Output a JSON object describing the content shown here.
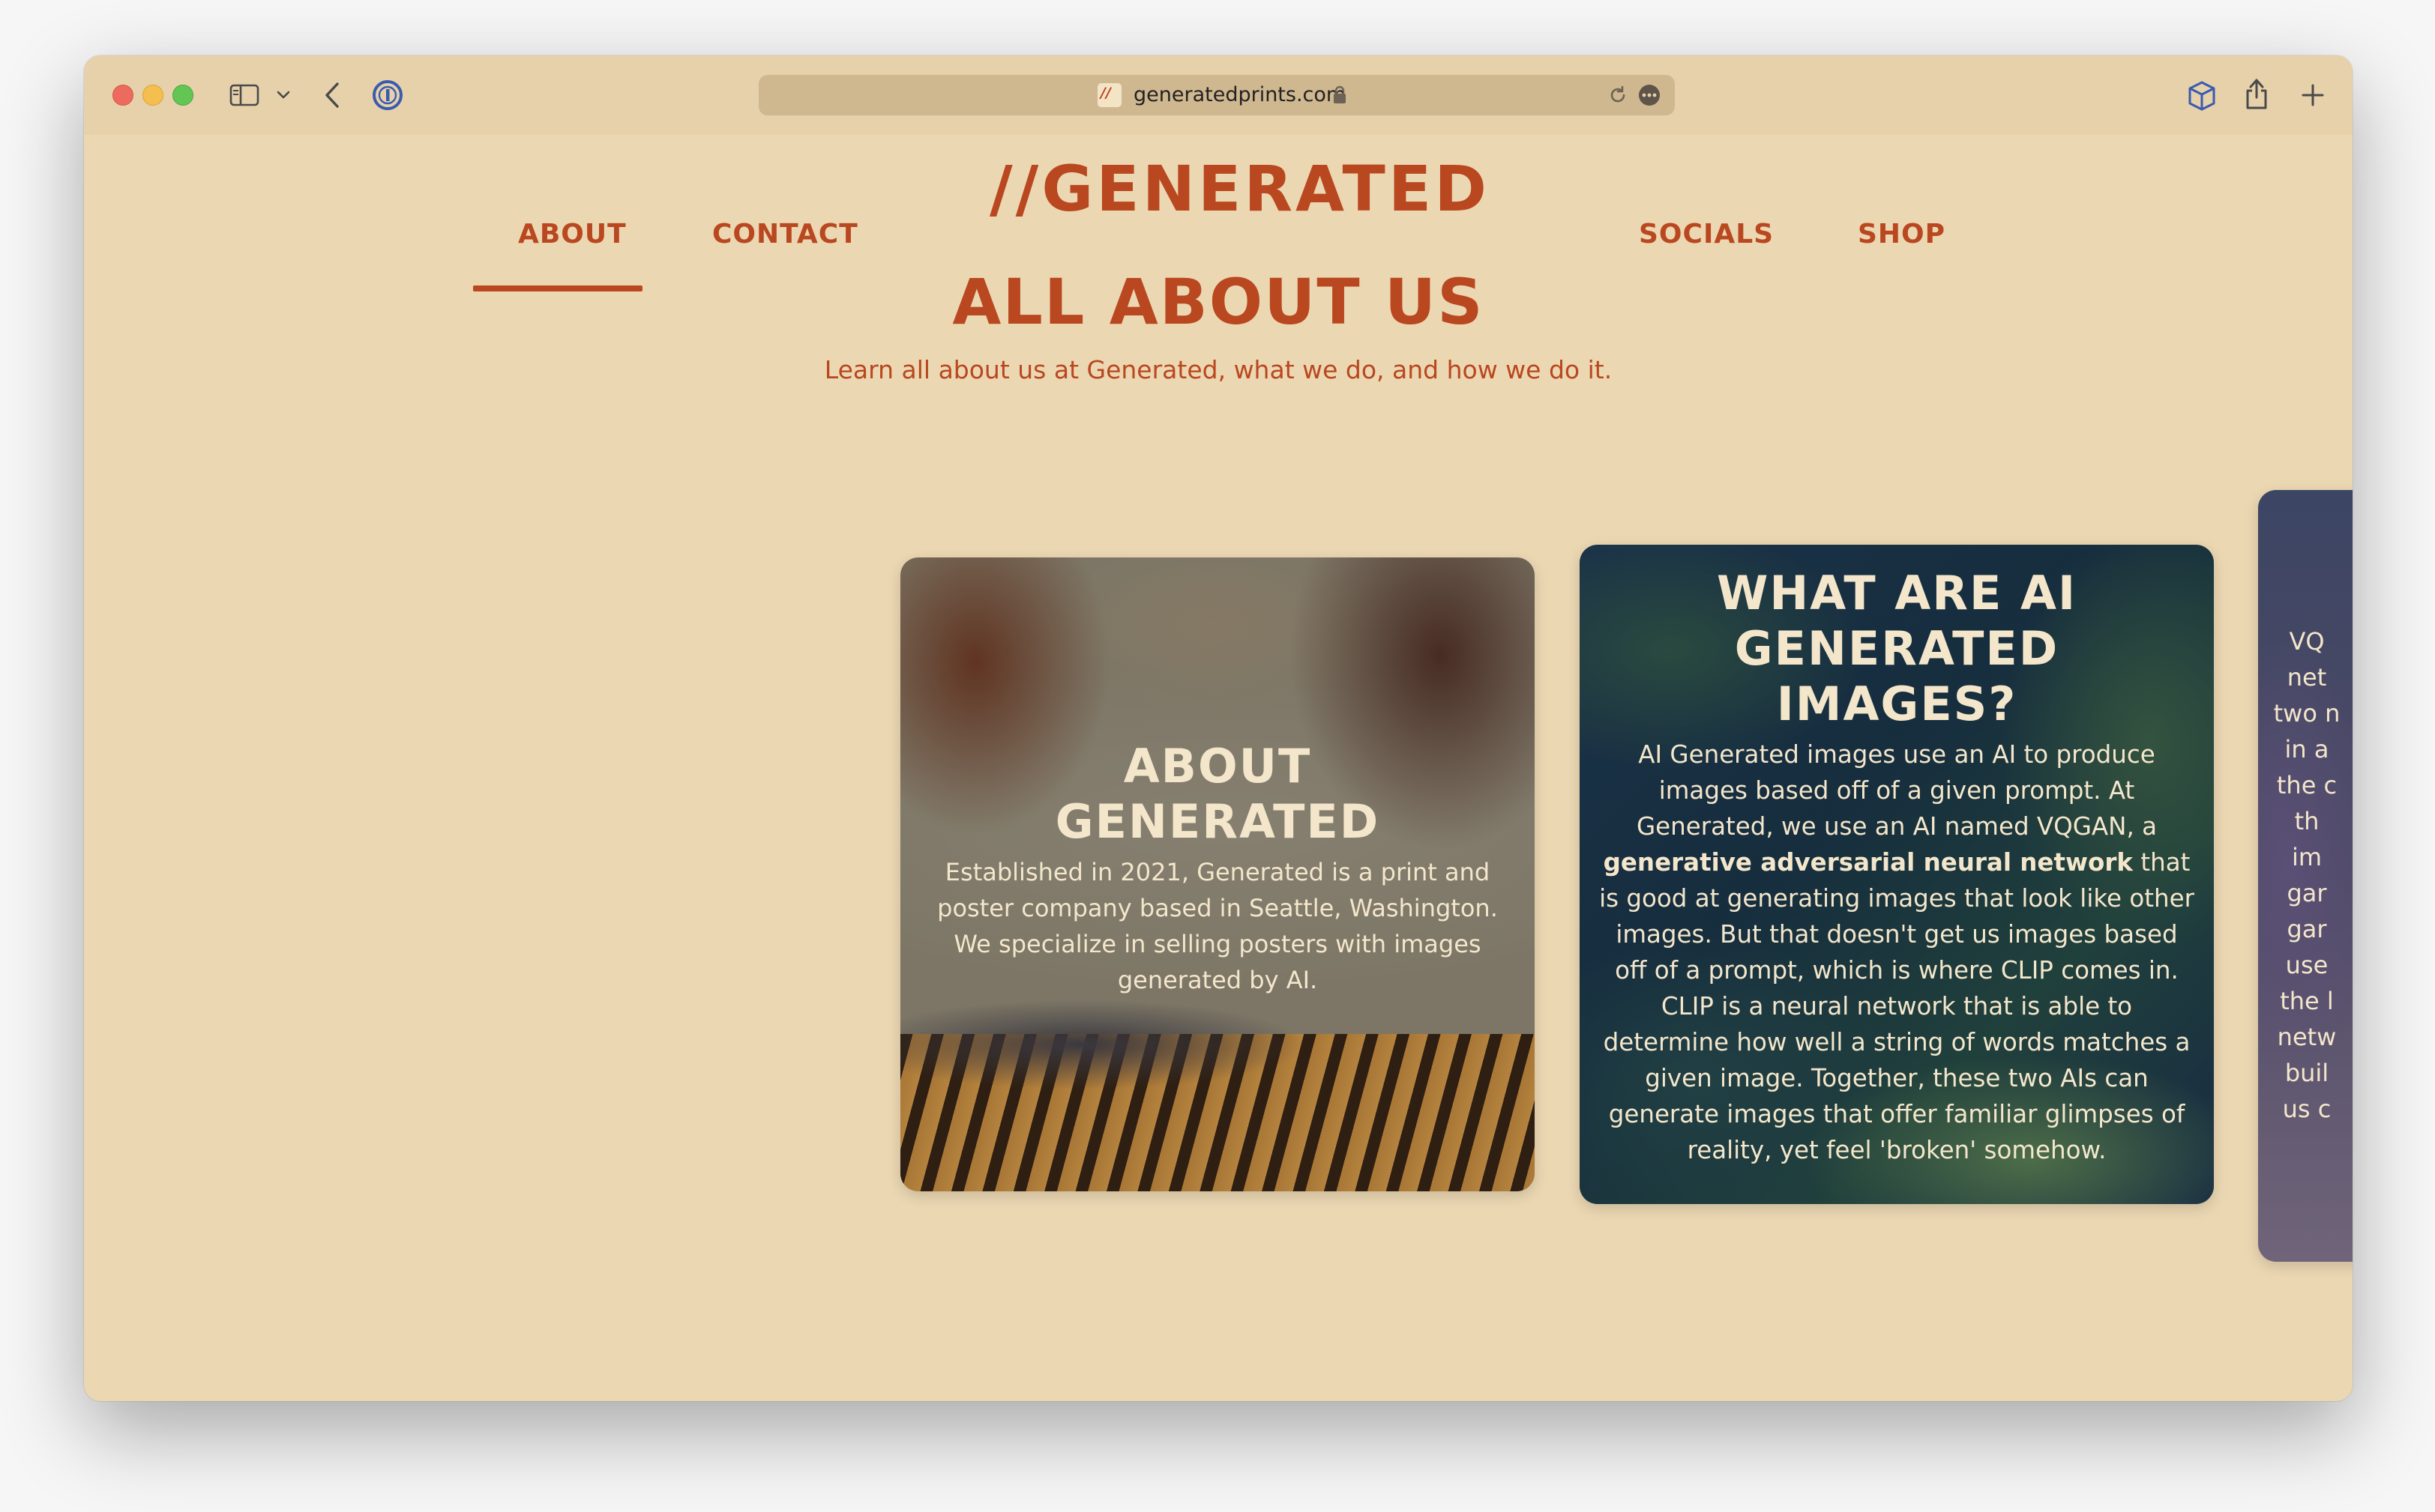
{
  "browser": {
    "url": "generatedprints.com",
    "favicon_text": "//"
  },
  "site": {
    "logo": "//GENERATED",
    "nav": [
      {
        "label": "ABOUT",
        "active": true
      },
      {
        "label": "CONTACT",
        "active": false
      },
      {
        "label": "SOCIALS",
        "active": false
      },
      {
        "label": "SHOP",
        "active": false
      }
    ]
  },
  "page": {
    "heading": "ALL ABOUT US",
    "subtitle": "Learn all about us at Generated, what we do, and how we do it."
  },
  "cards": [
    {
      "title": "ABOUT GENERATED",
      "body": "Established in 2021, Generated is a print and poster company based in Seattle, Washington. We specialize in selling posters with images generated by AI."
    },
    {
      "title": "WHAT ARE AI GENERATED IMAGES?",
      "body_before": "AI Generated images use an AI to produce images based off of a given prompt. At Generated, we use an AI named VQGAN, a ",
      "body_bold": "generative adversarial neural network",
      "body_after": " that is good at generating images that look like other images. But that doesn't get us images based off of a prompt, which is where CLIP comes in. CLIP is a neural network that is able to determine how well a string of words matches a given image. Together, these two AIs can generate images that offer familiar glimpses of reality, yet feel 'broken' somehow."
    },
    {
      "partial_lines": [
        "VQ",
        "net",
        "two n",
        "in a",
        "the c",
        "th",
        "im",
        "gar",
        "gar",
        "use",
        "the l",
        "netw",
        "buil",
        "us c"
      ]
    }
  ],
  "colors": {
    "brand": "#b9471f",
    "background": "#ebd7b2",
    "titlebar": "#e6d1aa",
    "card_text": "#f3e6cb"
  },
  "icons": [
    "sidebar-icon",
    "chevron-down-icon",
    "back-icon",
    "password-manager-icon",
    "lock-icon",
    "reload-icon",
    "more-icon",
    "extension-box-icon",
    "share-icon",
    "plus-icon"
  ]
}
